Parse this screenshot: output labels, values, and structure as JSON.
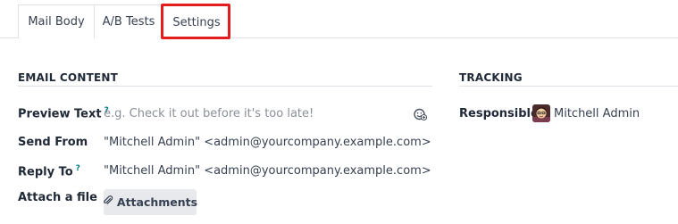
{
  "tabs": [
    {
      "label": "Mail Body"
    },
    {
      "label": "A/B Tests"
    },
    {
      "label": "Settings"
    }
  ],
  "email_content": {
    "title": "EMAIL CONTENT",
    "preview_text": {
      "label": "Preview Text",
      "help": "?",
      "placeholder": "e.g. Check it out before it's too late!"
    },
    "send_from": {
      "label": "Send From",
      "value": "\"Mitchell Admin\" <admin@yourcompany.example.com>"
    },
    "reply_to": {
      "label": "Reply To",
      "help": "?",
      "value": "\"Mitchell Admin\" <admin@yourcompany.example.com>"
    },
    "attach": {
      "label": "Attach a file",
      "button_label": "Attachments"
    }
  },
  "tracking": {
    "title": "TRACKING",
    "responsible": {
      "label": "Responsible",
      "value": "Mitchell Admin"
    }
  },
  "colors": {
    "highlight": "#e11d1d",
    "help_mark": "#017e84"
  },
  "icons": {
    "emoji": "smiley-icon",
    "attachment": "paperclip-icon",
    "avatar": "avatar"
  }
}
